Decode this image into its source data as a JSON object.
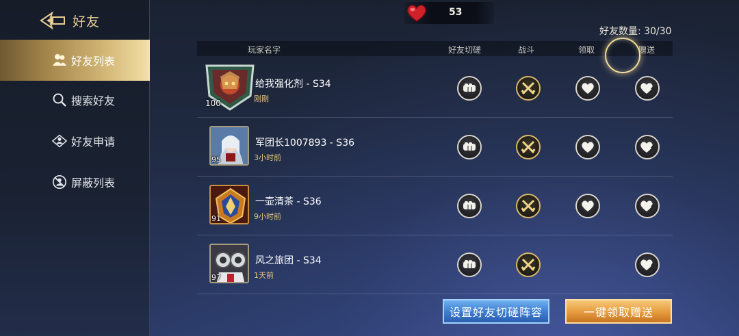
{
  "header": {
    "title": "好友"
  },
  "sidebar": {
    "items": [
      {
        "label": "好友列表",
        "icon": "friends-icon",
        "active": true
      },
      {
        "label": "搜索好友",
        "icon": "search-icon",
        "active": false
      },
      {
        "label": "好友申请",
        "icon": "friend-request-icon",
        "active": false
      },
      {
        "label": "屏蔽列表",
        "icon": "block-icon",
        "active": false
      }
    ]
  },
  "currency": {
    "icon": "heart-icon",
    "value": "53"
  },
  "friend_count": "好友数量: 30/30",
  "table": {
    "columns": [
      "玩家名字",
      "好友切磋",
      "战斗",
      "领取",
      "赠送"
    ],
    "rows": [
      {
        "name": "给我强化剂 - S34",
        "time": "刚刚",
        "level": "100",
        "can_receive": true
      },
      {
        "name": "军团长1007893 - S36",
        "time": "3小时前",
        "level": "95",
        "can_receive": true
      },
      {
        "name": "一壶清茶 - S36",
        "time": "9小时前",
        "level": "91",
        "can_receive": true
      },
      {
        "name": "风之旅团 - S34",
        "time": "1天前",
        "level": "97",
        "can_receive": false
      }
    ]
  },
  "buttons": {
    "lineup": "设置好友切磋阵容",
    "claim_all": "一键领取赠送"
  },
  "colors": {
    "accent_gold": "#e8cf95",
    "time_text": "#e5c47a",
    "blue_button": "#3f7fd0",
    "orange_button": "#e59a3c"
  }
}
